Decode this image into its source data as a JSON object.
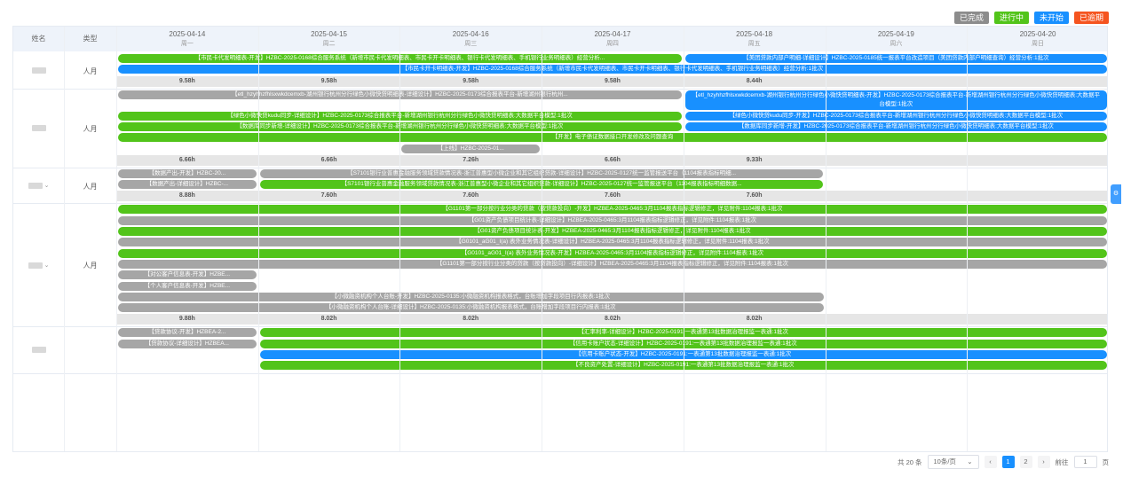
{
  "legend": [
    {
      "label": "已完成",
      "color": "#8c8c8c"
    },
    {
      "label": "进行中",
      "color": "#52c41a"
    },
    {
      "label": "未开始",
      "color": "#1890ff"
    },
    {
      "label": "已逾期",
      "color": "#f5541f"
    }
  ],
  "header": {
    "name": "姓名",
    "type": "类型"
  },
  "days": [
    {
      "date": "2025-04-14",
      "weekday": "周一"
    },
    {
      "date": "2025-04-15",
      "weekday": "周二"
    },
    {
      "date": "2025-04-16",
      "weekday": "周三"
    },
    {
      "date": "2025-04-17",
      "weekday": "周四"
    },
    {
      "date": "2025-04-18",
      "weekday": "周五"
    },
    {
      "date": "2025-04-19",
      "weekday": "周六"
    },
    {
      "date": "2025-04-20",
      "weekday": "周日"
    }
  ],
  "colors": {
    "gray": "#a6a6a6",
    "green": "#52c41a",
    "blue": "#1890ff"
  },
  "rows": [
    {
      "type": "人月",
      "chevron": "",
      "tasks": [
        {
          "start": 0,
          "end": 4,
          "color": "green",
          "text": "【市民卡代发明细表-开发】HZBC-2025-0168综合服务系统（新增市民卡代发明细表、市民卡开卡明细表、银行卡代发明细表、手机银行业务明细表）经营分析..."
        },
        {
          "start": 4,
          "end": 7,
          "color": "blue",
          "text": "【美团贷款内部户明细-详细设计】HZBC-2025-0185统一报表平台改造项目（美团贷款内部户明细查询）经营分析:1批次"
        },
        {
          "start": 0,
          "end": 7,
          "color": "blue",
          "text": "【市民卡开卡明细表-开发】HZBC-2025-0168综合服务系统（新增市民卡代发明细表、市民卡开卡明细表、银行卡代发明细表、手机银行业务明细表）经营分析:1批次"
        }
      ],
      "sums": [
        "9.58h",
        "9.58h",
        "9.58h",
        "9.58h",
        "8.44h",
        "",
        ""
      ]
    },
    {
      "type": "人月",
      "chevron": "",
      "tasks": [
        {
          "start": 0,
          "end": 4,
          "color": "gray",
          "text": "【etl_hzyhhzfhlsxwkdcemxb-湖州银行杭州分行绿色小微快贷明细表-详细设计】HZBC-2025-0173综合报表平台-新增湖州银行杭州..."
        },
        {
          "start": 4,
          "end": 7,
          "color": "blue",
          "tall": true,
          "text": "【etl_hzyhhzfhlsxwkdcemxb-湖州银行杭州分行绿色小微快贷明细表-开发】HZBC-2025-0173综合报表平台-新增湖州银行杭州分行绿色小微快贷明细表:大数据平台模型:1批次"
        },
        {
          "start": 0,
          "end": 4,
          "color": "green",
          "text": "【绿色小微快贷kudu同步-详细设计】HZBC-2025-0173综合报表平台-新增湖州银行杭州分行绿色小微快贷明细表:大数据平台模型:1批次"
        },
        {
          "start": 4,
          "end": 7,
          "color": "blue",
          "text": "【绿色小微快贷kudu同步-开发】HZBC-2025-0173综合报表平台-新增湖州银行杭州分行绿色小微快贷明细表:大数据平台模型:1批次"
        },
        {
          "start": 0,
          "end": 4,
          "color": "green",
          "text": "【数据库同步新增-详细设计】HZBC-2025-0173综合报表平台-新增湖州银行杭州分行绿色小微快贷明细表:大数据平台模型:1批次"
        },
        {
          "start": 4,
          "end": 7,
          "color": "blue",
          "text": "【数据库同步新增-开发】HZBC-2025-0173综合报表平台-新增湖州银行杭州分行绿色小微快贷明细表:大数据平台模型:1批次"
        },
        {
          "start": 0,
          "end": 7,
          "color": "green",
          "text": "【开发】电子债证数据接口开发修改及问题查询"
        },
        {
          "start": 2,
          "end": 3,
          "color": "gray",
          "text": "【上线】HZBC-2025-01..."
        }
      ],
      "sums": [
        "6.66h",
        "6.66h",
        "7.26h",
        "6.66h",
        "9.33h",
        "",
        ""
      ]
    },
    {
      "type": "人月",
      "chevron": "⌄",
      "tasks": [
        {
          "start": 0,
          "end": 1,
          "color": "gray",
          "text": "【数据产出-开发】HZBC-20..."
        },
        {
          "start": 1,
          "end": 5,
          "color": "gray",
          "text": "【S7101银行业普惠金融服务领域贷款情况表-浙江普惠型小微企业和其它组织贷款-详细设计】HZBC-2025-0127统一监管报送平台（1104报表指标明细..."
        },
        {
          "start": 0,
          "end": 1,
          "color": "gray",
          "text": "【数据产出-详细设计】HZBC-..."
        },
        {
          "start": 1,
          "end": 5,
          "color": "green",
          "text": "【S7101银行业普惠金融服务领域贷款情况表-浙江普惠型小微企业和其它组织贷款-详细设计】HZBC-2025-0127统一监管报送平台（1104报表指标明细数据..."
        }
      ],
      "sums": [
        "8.88h",
        "7.60h",
        "7.60h",
        "7.60h",
        "7.60h",
        "",
        ""
      ]
    },
    {
      "type": "人月",
      "chevron": "⌄",
      "tasks": [
        {
          "start": 0,
          "end": 7,
          "color": "green",
          "text": "【G1101第一部分按行业分类的贷款（按贷款投向）-开发】HZBEA-2025-0465:3月1104报表指标逻辑修正，详见附件:1104报表:1批次"
        },
        {
          "start": 0,
          "end": 7,
          "color": "gray",
          "text": "【G01资产负债项目统计表-详细设计】HZBEA-2025-0465:3月1104报表指标逻辑修正，详见附件:1104报表:1批次"
        },
        {
          "start": 0,
          "end": 7,
          "color": "green",
          "text": "【G01资产负债项目统计表-开发】HZBEA-2025-0465:3月1104报表指标逻辑修正，详见附件:1104报表:1批次"
        },
        {
          "start": 0,
          "end": 7,
          "color": "gray",
          "text": "【G0101_aG01_I(a) 表外业务情况表-详细设计】HZBEA-2025-0465:3月1104报表指标逻辑修正，详见附件:1104报表:1批次"
        },
        {
          "start": 0,
          "end": 7,
          "color": "green",
          "text": "【G0101_aG01_I(a) 表外业务情况表-开发】HZBEA-2025-0465:3月1104报表指标逻辑修正，详见附件:1104报表:1批次"
        },
        {
          "start": 0,
          "end": 7,
          "color": "gray",
          "text": "【G1101第一部分按行业分类的贷款（按贷款投向）-详细设计】HZBEA-2025-0465:3月1104报表指标逻辑修正，详见附件:1104报表:1批次"
        },
        {
          "start": 0,
          "end": 1,
          "color": "gray",
          "text": "【对公客户信息表-开发】HZBE..."
        },
        {
          "start": 0,
          "end": 1,
          "color": "gray",
          "text": "【个人客户信息表-开发】HZBE..."
        },
        {
          "start": 0,
          "end": 5,
          "color": "gray",
          "text": "【小微融资机构个人台账-开发】HZBC-2025-0135:小微融资机构报表格式，台账增加字段项目行内报表:1批次"
        },
        {
          "start": 0,
          "end": 5,
          "color": "gray",
          "text": "【小微融资机构个人台账-详细设计】HZBC-2025-0135:小微融资机构报表格式，台账增加字段项目行内报表:1批次"
        }
      ],
      "sums": [
        "9.88h",
        "8.02h",
        "8.02h",
        "8.02h",
        "8.02h",
        "",
        ""
      ]
    },
    {
      "type": "",
      "chevron": "",
      "tasks": [
        {
          "start": 0,
          "end": 1,
          "color": "gray",
          "text": "【贷款协议-开发】HZBEA-2..."
        },
        {
          "start": 1,
          "end": 7,
          "color": "green",
          "text": "【汇率利率-详细设计】HZBC-2025-0191:一表通第13批数据治理报监一表通:1批次"
        },
        {
          "start": 0,
          "end": 1,
          "color": "gray",
          "text": "【贷款协议-详细设计】HZBEA..."
        },
        {
          "start": 1,
          "end": 7,
          "color": "green",
          "text": "【信用卡账户状态-详细设计】HZBC-2025-0191:一表通第13批数据治理报监一表通:1批次"
        },
        {
          "start": 1,
          "end": 7,
          "color": "blue",
          "text": "【信用卡账户状态-开发】HZBC-2025-0191:一表通第13批数据治理报监一表通:1批次"
        },
        {
          "start": 1,
          "end": 7,
          "color": "green",
          "text": "【不良资产处置-详细设计】HZBC-2025-0191:一表通第13批数据治理报监一表通:1批次"
        }
      ],
      "sums": null
    }
  ],
  "pagination": {
    "total": "共 20 条",
    "page_size": "10条/页",
    "pages": [
      "1",
      "2"
    ],
    "goto_label": "前往",
    "goto_value": "1",
    "page_suffix": "页",
    "prev": "‹",
    "next": "›"
  },
  "side_button": "⚙"
}
